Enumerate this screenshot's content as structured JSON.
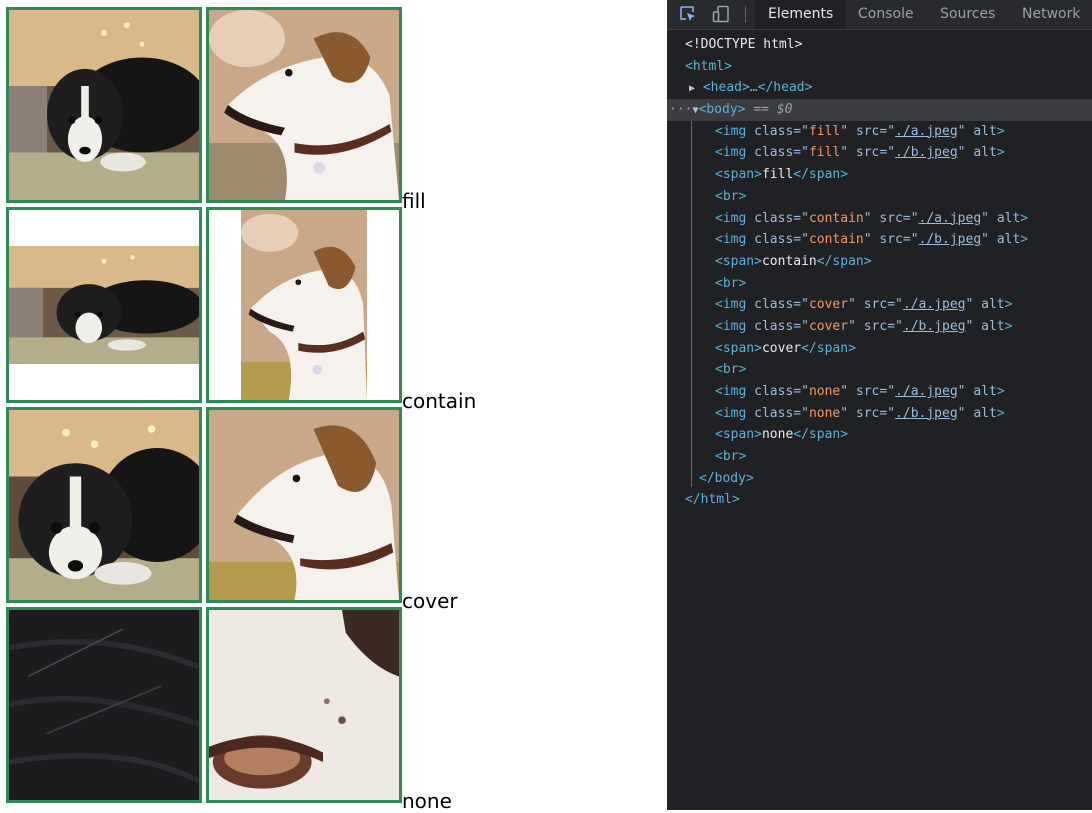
{
  "page": {
    "rows": [
      {
        "label": "fill"
      },
      {
        "label": "contain"
      },
      {
        "label": "cover"
      },
      {
        "label": "none"
      }
    ],
    "frame_border_color": "#2e8b57"
  },
  "devtools": {
    "tabs": [
      "Elements",
      "Console",
      "Sources",
      "Network"
    ],
    "active_tab": "Elements",
    "icons": [
      "inspect-element-icon",
      "device-toolbar-icon"
    ],
    "dom": {
      "doctype": "<!DOCTYPE html>",
      "html_open": "<html>",
      "head": "<head>",
      "head_ellipsis": "…",
      "head_close": "</head>",
      "body_open": "<body>",
      "body_marker": "== $0",
      "body_dots": "···",
      "body_close": "</body>",
      "html_close": "</html>",
      "img_tag": "<img",
      "class_attr": "class=",
      "src_attr": "src=",
      "alt_attr": "alt",
      "close_bracket": ">",
      "span_open": "<span>",
      "span_close": "</span>",
      "br": "<br>",
      "src_a": "./a.jpeg",
      "src_b": "./b.jpeg",
      "groups": [
        {
          "cls": "fill",
          "text": "fill"
        },
        {
          "cls": "contain",
          "text": "contain"
        },
        {
          "cls": "cover",
          "text": "cover"
        },
        {
          "cls": "none",
          "text": "none"
        }
      ]
    },
    "colors": {
      "background": "#202124",
      "toolbar": "#292a2d",
      "tag": "#5db0d7",
      "attribute": "#9bbbdc",
      "value": "#f29766",
      "selected_row": "#3c3d41"
    }
  }
}
